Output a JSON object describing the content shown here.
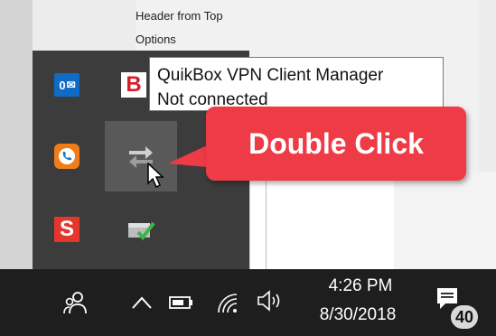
{
  "background_doc": {
    "line1": "Header from Top",
    "line2": "Options"
  },
  "tray_flyout": {
    "icons": [
      "outlook-icon",
      "b-app-icon",
      "phone-app-icon",
      "vpn-client-icon",
      "s-app-icon",
      "check-app-icon"
    ],
    "outlook_label": "0",
    "b_label": "B",
    "s_label": "S"
  },
  "tooltip": {
    "line1": "QuikBox VPN Client Manager",
    "line2": "Not connected"
  },
  "callout": {
    "text": "Double Click",
    "color": "#ef3b45"
  },
  "taskbar": {
    "time": "4:26 PM",
    "date": "8/30/2018",
    "notification_count": "40",
    "icons": [
      "people-icon",
      "chevron-up-icon",
      "battery-icon",
      "wifi-icon",
      "volume-icon",
      "notification-icon"
    ]
  }
}
